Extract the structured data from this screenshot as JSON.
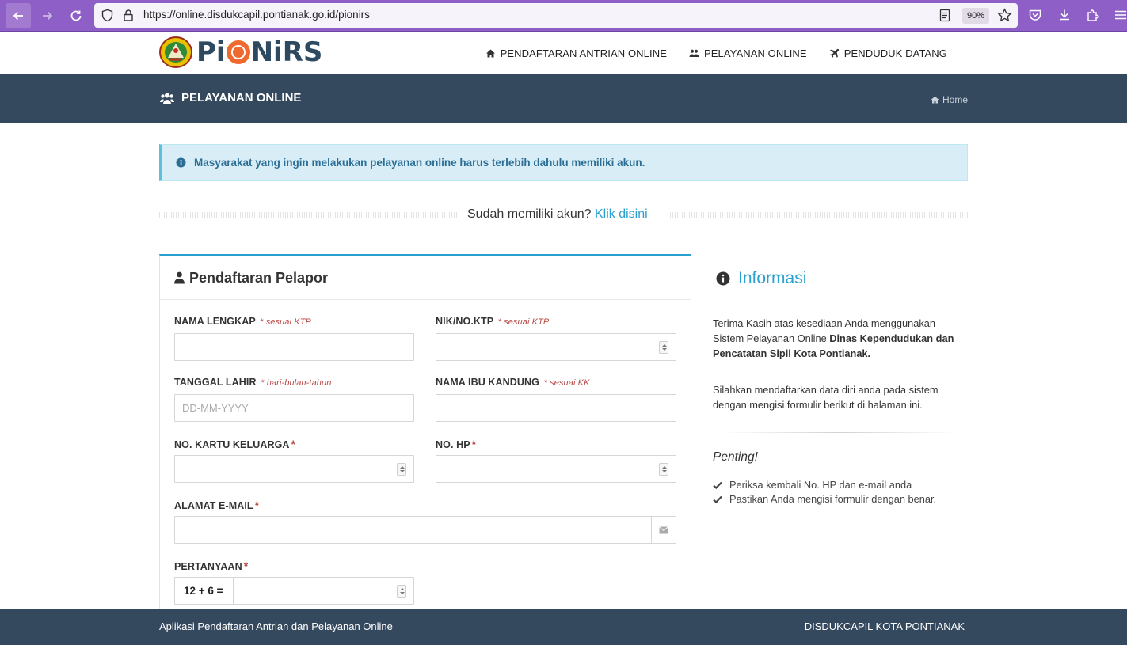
{
  "browser": {
    "url": "https://online.disdukcapil.pontianak.go.id/pionirs",
    "zoom": "90%"
  },
  "header": {
    "logo_text": "PiONiRS",
    "nav": [
      {
        "label": "PENDAFTARAN ANTRIAN ONLINE",
        "icon": "home-icon"
      },
      {
        "label": "PELAYANAN ONLINE",
        "icon": "users-icon"
      },
      {
        "label": "PENDUDUK DATANG",
        "icon": "plane-icon"
      }
    ]
  },
  "page": {
    "title": "PELAYANAN ONLINE",
    "breadcrumb": "Home"
  },
  "alert": {
    "text": "Masyarakat yang ingin melakukan pelayanan online harus terlebih dahulu memiliki akun."
  },
  "login": {
    "prompt": "Sudah memiliki akun?",
    "link": "Klik disini"
  },
  "form": {
    "title": "Pendaftaran Pelapor",
    "fields": {
      "nama": {
        "label": "NAMA LENGKAP",
        "hint": "* sesuai KTP",
        "value": ""
      },
      "nik": {
        "label": "NIK/NO.KTP",
        "hint": "* sesuai KTP",
        "value": ""
      },
      "tgl": {
        "label": "TANGGAL LAHIR",
        "hint": "* hari-bulan-tahun",
        "placeholder": "DD-MM-YYYY"
      },
      "ibu": {
        "label": "NAMA IBU KANDUNG",
        "hint": "* sesuai KK",
        "value": ""
      },
      "kk": {
        "label": "NO. KARTU KELUARGA",
        "req": "*",
        "value": ""
      },
      "hp": {
        "label": "NO. HP",
        "req": "*",
        "value": ""
      },
      "email": {
        "label": "ALAMAT E-MAIL",
        "req": "*",
        "value": ""
      },
      "tanya": {
        "label": "PERTANYAAN",
        "req": "*",
        "question": "12 + 6 =",
        "value": ""
      }
    }
  },
  "info": {
    "title": "Informasi",
    "p1_a": "Terima Kasih atas kesediaan Anda menggunakan Sistem Pelayanan Online ",
    "p1_b": "Dinas Kependudukan dan Pencatatan Sipil Kota Pontianak.",
    "p2": "Silahkan mendaftarkan data diri anda pada sistem dengan mengisi formulir berikut di halaman ini.",
    "penting": "Penting!",
    "checks": [
      "Periksa kembali No. HP dan e-mail anda",
      "Pastikan Anda mengisi formulir dengan benar."
    ]
  },
  "footer": {
    "left": "Aplikasi Pendaftaran Antrian dan Pelayanan Online",
    "right": "DISDUKCAPIL KOTA PONTIANAK"
  },
  "colors": {
    "browser_bar": "#8e5fc7",
    "band": "#35495e",
    "accent": "#2aa0cf",
    "logo_orange": "#ee6a2e",
    "required": "#b94a48"
  }
}
